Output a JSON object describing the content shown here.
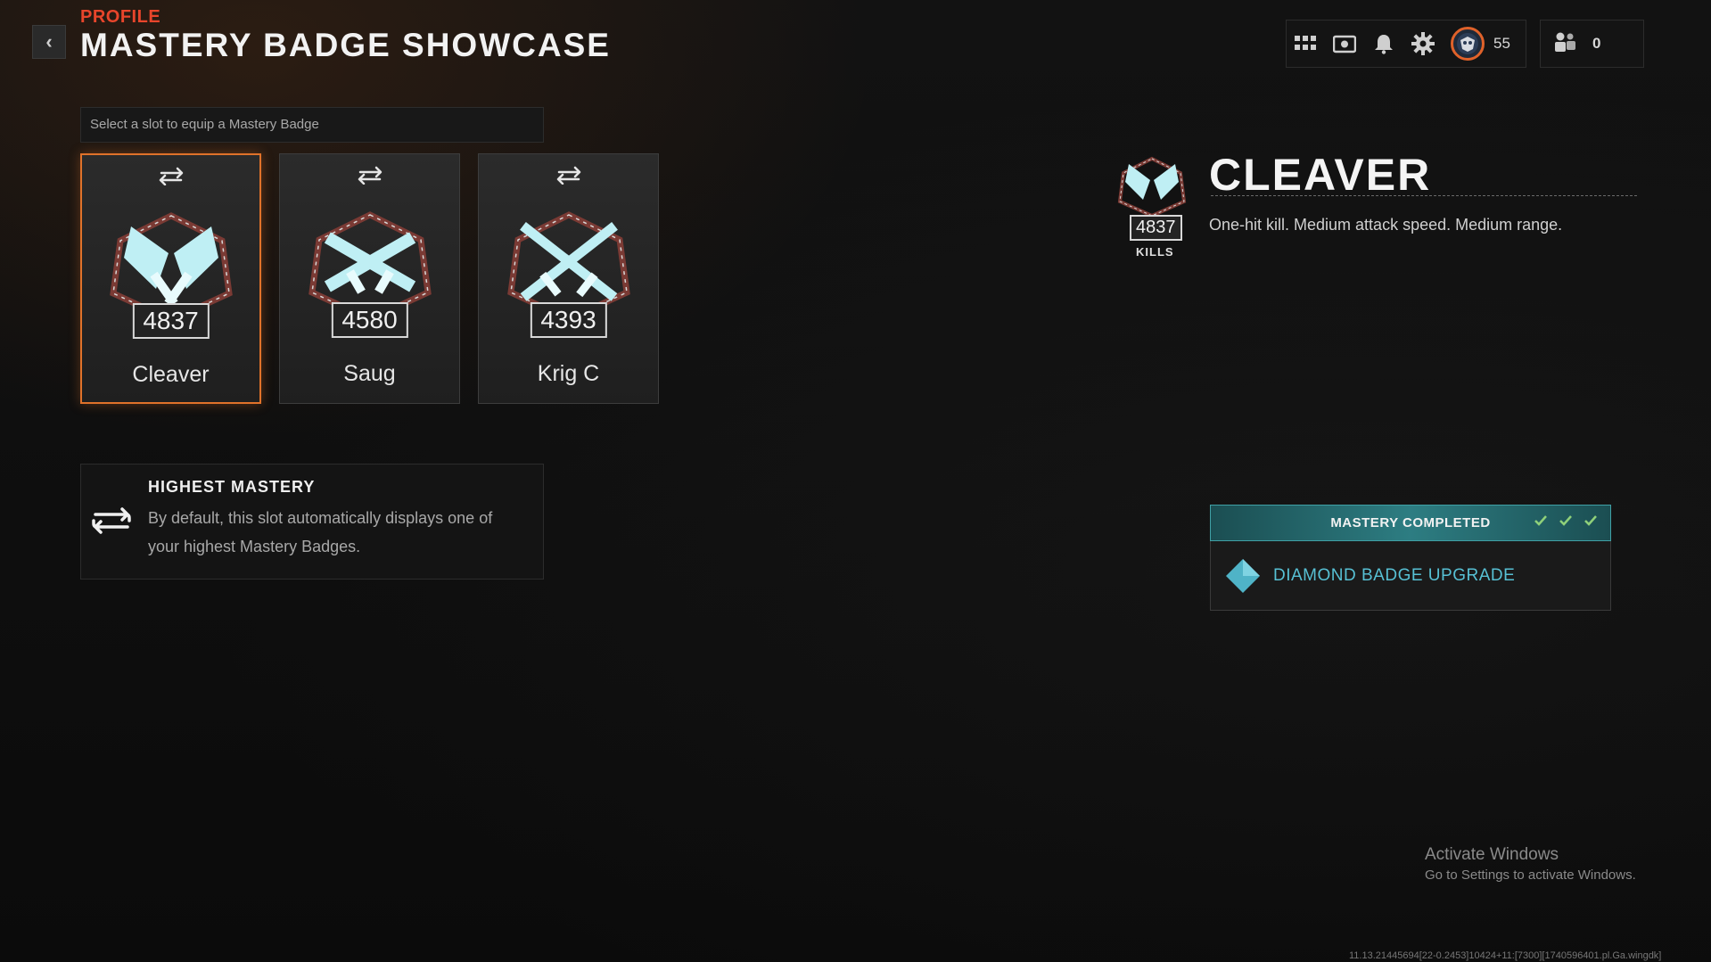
{
  "header": {
    "back_icon": "‹",
    "breadcrumb": "PROFILE",
    "title": "MASTERY BADGE SHOWCASE"
  },
  "topnav": {
    "icons": [
      "grid-menu-icon",
      "wallet-icon",
      "bell-icon",
      "gear-icon"
    ],
    "level": "55",
    "friends_count": "0"
  },
  "instruction": "Select a slot to equip a Mastery Badge",
  "slots": [
    {
      "kills": "4837",
      "name": "Cleaver",
      "selected": true
    },
    {
      "kills": "4580",
      "name": "Saug",
      "selected": false
    },
    {
      "kills": "4393",
      "name": "Krig C",
      "selected": false
    }
  ],
  "highest_mastery": {
    "title": "HIGHEST MASTERY",
    "description": "By default, this slot automatically displays one of your highest Mastery Badges."
  },
  "detail": {
    "kills": "4837",
    "kills_label": "KILLS",
    "title": "CLEAVER",
    "description": "One-hit kill.  Medium attack speed. Medium range."
  },
  "mastery": {
    "header": "MASTERY COMPLETED",
    "upgrade": "DIAMOND BADGE UPGRADE",
    "accent": "#57c0d4"
  },
  "watermark": {
    "line1": "Activate Windows",
    "line2": "Go to Settings to activate Windows."
  },
  "build": "11.13.21445694[22-0.2453]10424+11:[7300][1740596401.pl.Ga.wingdk]"
}
